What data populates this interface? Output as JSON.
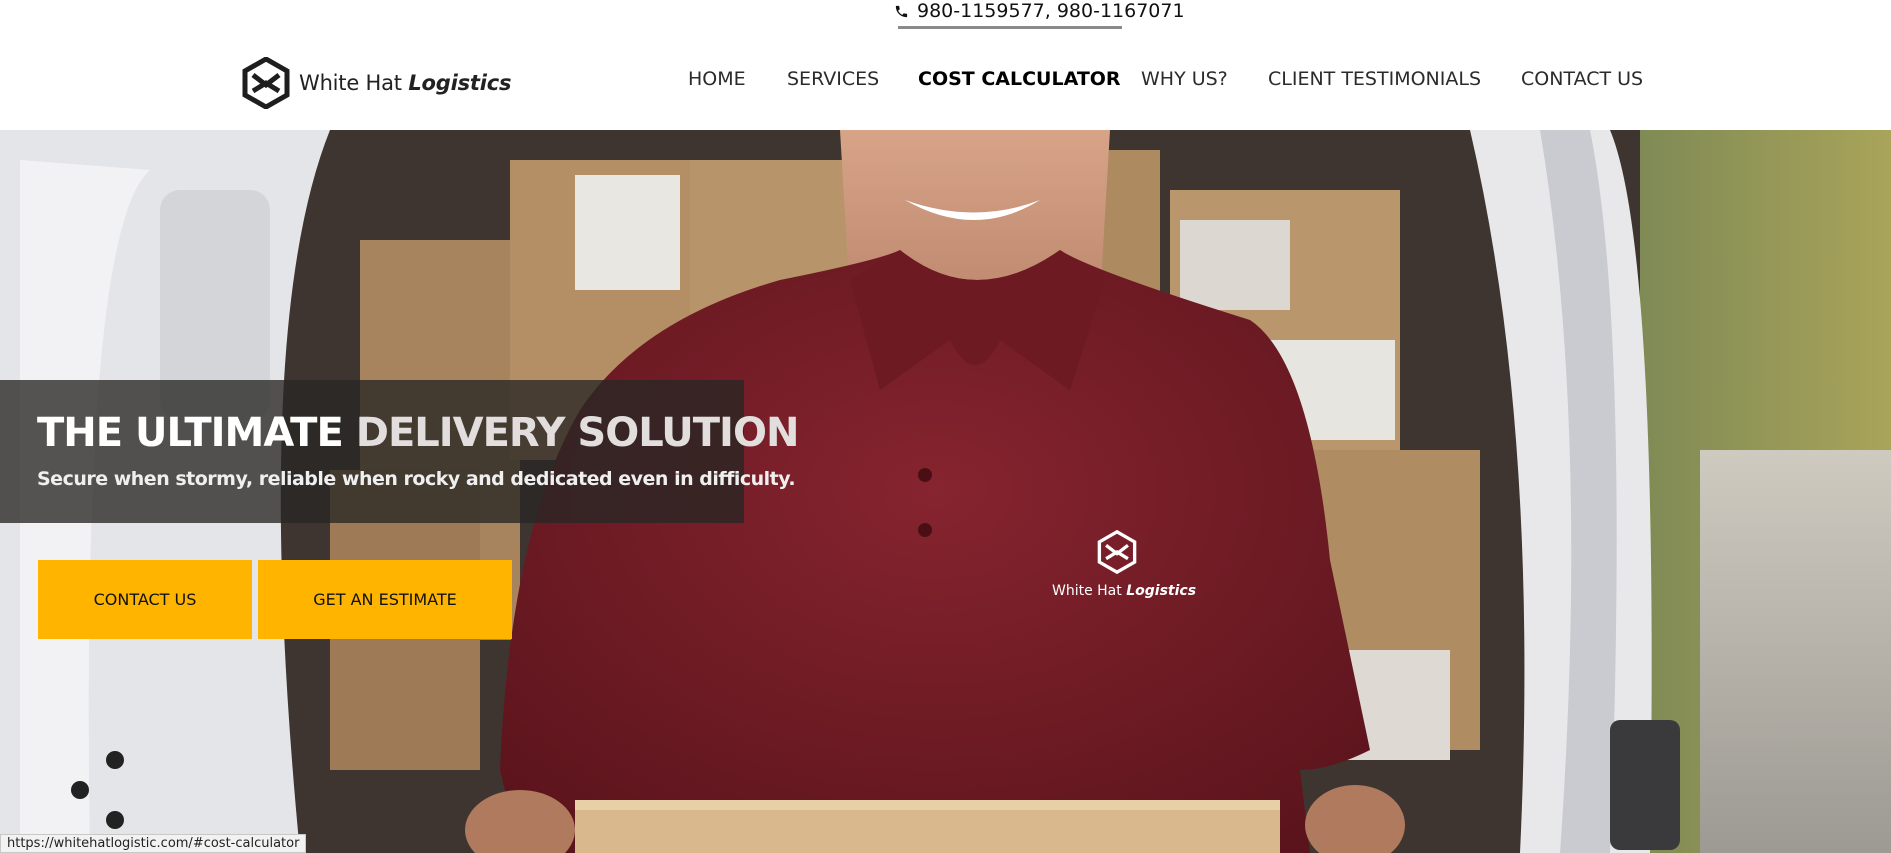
{
  "topbar": {
    "phone_icon": "phone-icon",
    "phone_numbers": "980-1159577, 980-1167071"
  },
  "header": {
    "logo": {
      "icon": "hexagon-logo-icon",
      "name_plain": "White Hat",
      "name_bold": "Logistics"
    },
    "nav": [
      {
        "label": "HOME",
        "active": false
      },
      {
        "label": "SERVICES",
        "active": false
      },
      {
        "label": "COST CALCULATOR",
        "active": true
      },
      {
        "label": "WHY US?",
        "active": false
      },
      {
        "label": "CLIENT TESTIMONIALS",
        "active": false
      },
      {
        "label": "CONTACT US",
        "active": false
      }
    ]
  },
  "hero": {
    "title_part1": "THE ULTIMATE",
    "title_part2": "DELIVERY SOLUTION",
    "subtitle": "Secure when stormy, reliable when rocky and dedicated even in difficulty.",
    "buttons": {
      "contact": "CONTACT US",
      "estimate": "GET AN ESTIMATE"
    },
    "shirt_logo": {
      "name_plain": "White Hat",
      "name_bold": "Logistics"
    }
  },
  "status_url": "https://whitehatlogistic.com/#cost-calculator",
  "colors": {
    "accent": "#ffb400",
    "shirt": "#7a1e27"
  }
}
